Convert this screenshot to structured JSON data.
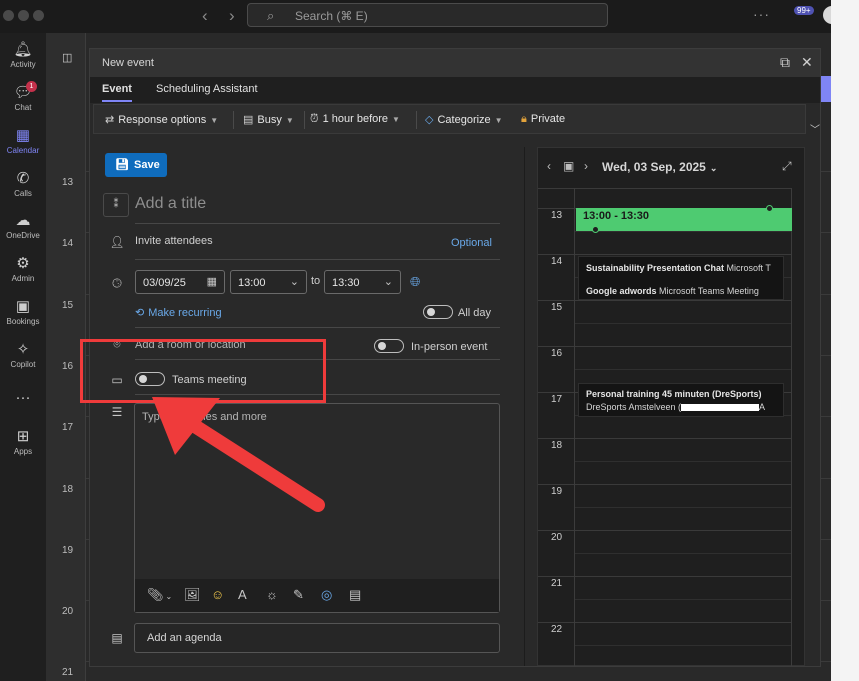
{
  "titlebar": {
    "search_placeholder": "Search (⌘ E)",
    "notification_count": "99+",
    "nav_back_icon": "chevron-left-icon",
    "nav_forward_icon": "chevron-right-icon"
  },
  "rail": {
    "items": [
      {
        "label": "Activity",
        "icon": "bell-icon"
      },
      {
        "label": "Chat",
        "icon": "chat-icon",
        "badge": "1"
      },
      {
        "label": "Calendar",
        "icon": "calendar-icon"
      },
      {
        "label": "Calls",
        "icon": "phone-icon"
      },
      {
        "label": "OneDrive",
        "icon": "cloud-icon"
      },
      {
        "label": "Admin",
        "icon": "admin-icon"
      },
      {
        "label": "Bookings",
        "icon": "bookings-icon"
      },
      {
        "label": "Copilot",
        "icon": "copilot-icon"
      },
      {
        "label": "Apps",
        "icon": "plus-square-icon"
      }
    ]
  },
  "background_calendar": {
    "hours": [
      "13",
      "14",
      "15",
      "16",
      "17",
      "18",
      "19",
      "20",
      "21"
    ]
  },
  "modal": {
    "title": "New event",
    "tabs": [
      {
        "label": "Event",
        "active": true
      },
      {
        "label": "Scheduling Assistant",
        "active": false
      }
    ],
    "toolbar": {
      "response_options": "Response options",
      "busy": "Busy",
      "reminder": "1 hour before",
      "categorize": "Categorize",
      "private": "Private"
    },
    "form": {
      "save_label": "Save",
      "title_placeholder": "Add a title",
      "attendees_placeholder": "Invite attendees",
      "optional_link": "Optional",
      "date": "03/09/25",
      "start_time": "13:00",
      "to_label": "to",
      "end_time": "13:30",
      "recurring_link": "Make recurring",
      "all_day_label": "All day",
      "all_day_on": false,
      "location_placeholder": "Add a room or location",
      "in_person_label": "In-person event",
      "in_person_on": false,
      "teams_meeting_label": "Teams meeting",
      "teams_meeting_on": false,
      "editor_placeholder": "Type",
      "editor_placeholder_tail": "rt files and more",
      "agenda_placeholder": "Add an agenda"
    },
    "dayview": {
      "date_label": "Wed, 03 Sep, 2025",
      "hours": [
        "13",
        "14",
        "15",
        "16",
        "17",
        "18",
        "19",
        "20",
        "21",
        "22"
      ],
      "new_event_label": "13:00 - 13:30",
      "new_event_color": "#4ecb71",
      "events": [
        {
          "title": "Sustainability Presentation Chat",
          "detail": "Microsoft T"
        },
        {
          "title": "Google adwords",
          "detail": "Microsoft Teams Meeting"
        },
        {
          "title": "Personal training 45 minuten (DreSports)",
          "detail": "DreSports Amstelveen (",
          "detail_tail": "A"
        }
      ]
    }
  },
  "annotation": {
    "color": "#ef3b3b"
  }
}
